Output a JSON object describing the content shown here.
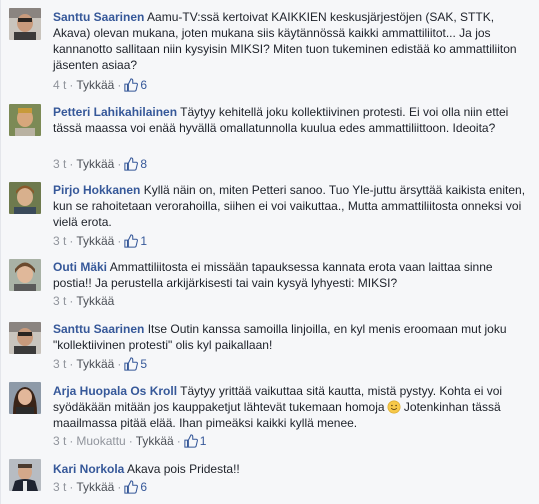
{
  "comments": [
    {
      "name": "Santtu Saarinen",
      "text": "Aamu-TV:ssä kertoivat KAIKKIEN keskusjärjestöjen (SAK, STTK, Akava) olevan mukana, joten mukana siis käytännössä kaikki ammattiliitot... Ja jos kannanotto sallitaan niin kysyisin MIKSI? Miten tuon tukeminen edistää ko ammattiliiton jäsenten asiaa?",
      "time": "4 t",
      "like_label": "Tykkää",
      "like_count": "6"
    },
    {
      "name": "Petteri Lahikahilainen",
      "text": "Täytyy kehitellä joku kollektiivinen protesti. Ei voi olla niin ettei tässä maassa voi enää hyvällä omallatunnolla kuulua edes ammattiliittoon. Ideoita?",
      "time": "3 t",
      "like_label": "Tykkää",
      "like_count": "8"
    },
    {
      "name": "Pirjo Hokkanen",
      "text": "Kyllä näin on, miten Petteri sanoo. Tuo Yle-juttu ärsyttää kaikista eniten, kun se rahoitetaan verorahoilla, siihen ei voi vaikuttaa., Mutta ammattiliitosta onneksi voi vielä erota.",
      "time": "3 t",
      "like_label": "Tykkää",
      "like_count": "1"
    },
    {
      "name": "Outi Mäki",
      "text": "Ammattiliitosta ei missään tapauksessa kannata erota vaan laittaa sinne postia!! Ja perustella arkijärkisesti tai vain kysyä lyhyesti: MIKSI?",
      "time": "3 t",
      "like_label": "Tykkää"
    },
    {
      "name": "Santtu Saarinen",
      "text": "Itse Outin kanssa samoilla linjoilla, en kyl menis eroomaan mut joku \"kollektiivinen protesti\" olis kyl paikallaan!",
      "time": "3 t",
      "like_label": "Tykkää",
      "like_count": "5"
    },
    {
      "name": "Arja Huopala Os Kroll",
      "text": "Täytyy yrittää vaikuttaa sitä kautta, mistä pystyy. Kohta ei voi syödäkään mitään jos kauppaketjut lähtevät tukemaan homoja",
      "text_after_emoji": "Jotenkinhan tässä maailmassa pitää elää. Ihan pimeäksi kaikki kyllä menee.",
      "emoji": "smiley-emoji",
      "time": "3 t",
      "edited_label": "Muokattu",
      "like_label": "Tykkää",
      "like_count": "1"
    },
    {
      "name": "Kari Norkola",
      "text": "Akava pois Pridesta!!",
      "time": "3 t",
      "like_label": "Tykkää",
      "like_count": "6"
    }
  ],
  "icons": {
    "like": "thumbs-up-icon"
  },
  "colors": {
    "name": "#365899",
    "text": "#1d2129",
    "meta": "#90949c",
    "background": "#f6f7f9"
  }
}
